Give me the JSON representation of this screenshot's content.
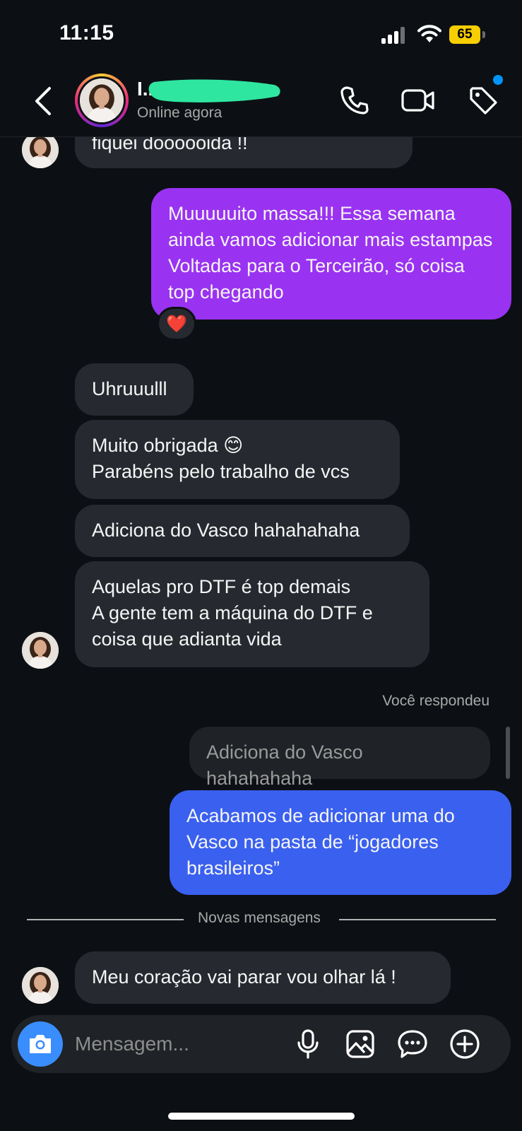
{
  "status_bar": {
    "time": "11:15",
    "battery": "65"
  },
  "header": {
    "contact_name": "I...",
    "status": "Online agora",
    "icons": [
      "back-icon",
      "phone-icon",
      "video-camera-icon",
      "tag-icon"
    ],
    "notification_dot_color": "#0095f6"
  },
  "messages": [
    {
      "from": "contact",
      "text": "fiquei doooooida !!"
    },
    {
      "from": "me",
      "text": "Muuuuuito massa!!! Essa semana ainda vamos adicionar mais estampas Voltadas para o Terceirão, só coisa top chegando",
      "reaction": "❤️"
    },
    {
      "from": "contact",
      "text": "Uhruuulll"
    },
    {
      "from": "contact",
      "text": "Muito obrigada 😊\nParabéns pelo trabalho de vcs"
    },
    {
      "from": "contact",
      "text": "Adiciona do Vasco hahahahaha"
    },
    {
      "from": "contact",
      "text": "Aquelas pro DTF é top demais\nA gente tem a máquina do DTF e coisa que adianta vida"
    },
    {
      "reply_label": "Você respondeu",
      "quoted": "Adiciona do Vasco hahahahaha"
    },
    {
      "from": "me",
      "text": "Acabamos de adicionar uma do Vasco na pasta de “jogadores brasileiros”"
    },
    {
      "divider": "Novas mensagens"
    },
    {
      "from": "contact",
      "text": "Meu coração vai parar vou olhar lá !"
    }
  ],
  "composer": {
    "placeholder": "Mensagem...",
    "icons": [
      "camera-icon",
      "microphone-icon",
      "gallery-icon",
      "sticker-icon",
      "plus-icon"
    ]
  },
  "colors": {
    "background": "#0c1014",
    "received_bubble": "#262a30",
    "sent_bubble_purple": "#9a32f2",
    "sent_bubble_blue": "#3a60ef",
    "camera_button": "#3a8dfc"
  }
}
